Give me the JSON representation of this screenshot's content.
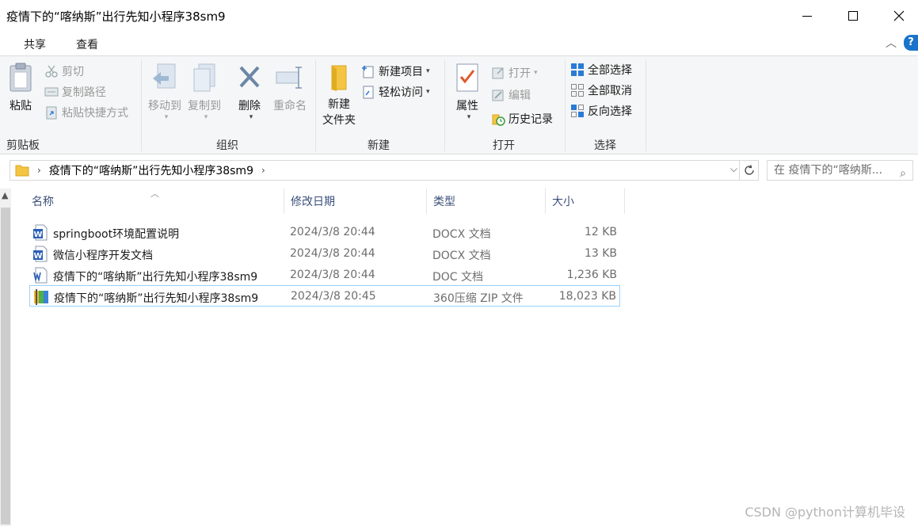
{
  "window": {
    "title": "疫情下的“喀纳斯”出行先知小程序38sm9"
  },
  "ribbon_tabs": [
    "共享",
    "查看"
  ],
  "ribbon": {
    "clipboard": {
      "paste": "粘贴",
      "cut": "剪切",
      "copy_path": "复制路径",
      "paste_shortcut": "粘贴快捷方式",
      "group": "剪贴板"
    },
    "organize": {
      "move_to": "移动到",
      "copy_to": "复制到",
      "delete": "删除",
      "rename": "重命名",
      "group": "组织"
    },
    "new": {
      "new_folder_line1": "新建",
      "new_folder_line2": "文件夹",
      "new_item": "新建项目",
      "easy_access": "轻松访问",
      "group": "新建"
    },
    "open": {
      "properties": "属性",
      "open": "打开",
      "edit": "编辑",
      "history": "历史记录",
      "group": "打开"
    },
    "select": {
      "select_all": "全部选择",
      "select_none": "全部取消",
      "invert": "反向选择",
      "group": "选择"
    }
  },
  "address": {
    "breadcrumb": "疫情下的“喀纳斯”出行先知小程序38sm9",
    "search_placeholder": "在 疫情下的“喀纳斯...",
    "search_glyph": "⌕"
  },
  "columns": {
    "name": "名称",
    "date": "修改日期",
    "type": "类型",
    "size": "大小"
  },
  "files": [
    {
      "name": "springboot环境配置说明",
      "date": "2024/3/8 20:44",
      "type": "DOCX 文档",
      "size": "12 KB",
      "icon": "word-docx-icon"
    },
    {
      "name": "微信小程序开发文档",
      "date": "2024/3/8 20:44",
      "type": "DOCX 文档",
      "size": "13 KB",
      "icon": "word-docx-icon"
    },
    {
      "name": "疫情下的“喀纳斯”出行先知小程序38sm9",
      "date": "2024/3/8 20:44",
      "type": "DOC 文档",
      "size": "1,236 KB",
      "icon": "word-doc-icon"
    },
    {
      "name": "疫情下的“喀纳斯”出行先知小程序38sm9",
      "date": "2024/3/8 20:45",
      "type": "360压缩 ZIP 文件",
      "size": "18,023 KB",
      "icon": "zip-archive-icon"
    }
  ],
  "watermark": "CSDN @python计算机毕设",
  "colors": {
    "accent": "#1a73c9",
    "selection_border": "#99d1ff",
    "word_blue": "#2b5fb8"
  }
}
